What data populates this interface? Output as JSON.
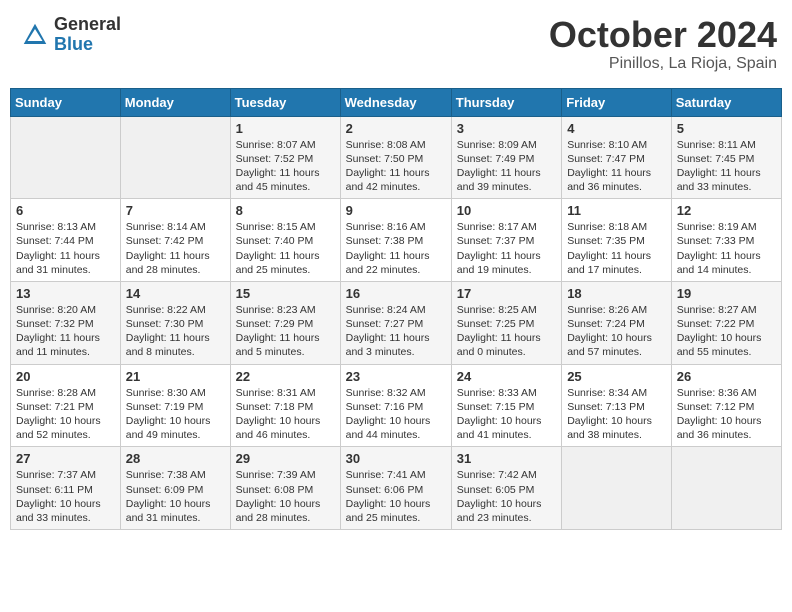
{
  "header": {
    "logo_general": "General",
    "logo_blue": "Blue",
    "month_title": "October 2024",
    "location": "Pinillos, La Rioja, Spain"
  },
  "weekdays": [
    "Sunday",
    "Monday",
    "Tuesday",
    "Wednesday",
    "Thursday",
    "Friday",
    "Saturday"
  ],
  "weeks": [
    [
      {
        "day": "",
        "empty": true
      },
      {
        "day": "",
        "empty": true
      },
      {
        "day": "1",
        "sunrise": "8:07 AM",
        "sunset": "7:52 PM",
        "daylight": "11 hours and 45 minutes."
      },
      {
        "day": "2",
        "sunrise": "8:08 AM",
        "sunset": "7:50 PM",
        "daylight": "11 hours and 42 minutes."
      },
      {
        "day": "3",
        "sunrise": "8:09 AM",
        "sunset": "7:49 PM",
        "daylight": "11 hours and 39 minutes."
      },
      {
        "day": "4",
        "sunrise": "8:10 AM",
        "sunset": "7:47 PM",
        "daylight": "11 hours and 36 minutes."
      },
      {
        "day": "5",
        "sunrise": "8:11 AM",
        "sunset": "7:45 PM",
        "daylight": "11 hours and 33 minutes."
      }
    ],
    [
      {
        "day": "6",
        "sunrise": "8:13 AM",
        "sunset": "7:44 PM",
        "daylight": "11 hours and 31 minutes."
      },
      {
        "day": "7",
        "sunrise": "8:14 AM",
        "sunset": "7:42 PM",
        "daylight": "11 hours and 28 minutes."
      },
      {
        "day": "8",
        "sunrise": "8:15 AM",
        "sunset": "7:40 PM",
        "daylight": "11 hours and 25 minutes."
      },
      {
        "day": "9",
        "sunrise": "8:16 AM",
        "sunset": "7:38 PM",
        "daylight": "11 hours and 22 minutes."
      },
      {
        "day": "10",
        "sunrise": "8:17 AM",
        "sunset": "7:37 PM",
        "daylight": "11 hours and 19 minutes."
      },
      {
        "day": "11",
        "sunrise": "8:18 AM",
        "sunset": "7:35 PM",
        "daylight": "11 hours and 17 minutes."
      },
      {
        "day": "12",
        "sunrise": "8:19 AM",
        "sunset": "7:33 PM",
        "daylight": "11 hours and 14 minutes."
      }
    ],
    [
      {
        "day": "13",
        "sunrise": "8:20 AM",
        "sunset": "7:32 PM",
        "daylight": "11 hours and 11 minutes."
      },
      {
        "day": "14",
        "sunrise": "8:22 AM",
        "sunset": "7:30 PM",
        "daylight": "11 hours and 8 minutes."
      },
      {
        "day": "15",
        "sunrise": "8:23 AM",
        "sunset": "7:29 PM",
        "daylight": "11 hours and 5 minutes."
      },
      {
        "day": "16",
        "sunrise": "8:24 AM",
        "sunset": "7:27 PM",
        "daylight": "11 hours and 3 minutes."
      },
      {
        "day": "17",
        "sunrise": "8:25 AM",
        "sunset": "7:25 PM",
        "daylight": "11 hours and 0 minutes."
      },
      {
        "day": "18",
        "sunrise": "8:26 AM",
        "sunset": "7:24 PM",
        "daylight": "10 hours and 57 minutes."
      },
      {
        "day": "19",
        "sunrise": "8:27 AM",
        "sunset": "7:22 PM",
        "daylight": "10 hours and 55 minutes."
      }
    ],
    [
      {
        "day": "20",
        "sunrise": "8:28 AM",
        "sunset": "7:21 PM",
        "daylight": "10 hours and 52 minutes."
      },
      {
        "day": "21",
        "sunrise": "8:30 AM",
        "sunset": "7:19 PM",
        "daylight": "10 hours and 49 minutes."
      },
      {
        "day": "22",
        "sunrise": "8:31 AM",
        "sunset": "7:18 PM",
        "daylight": "10 hours and 46 minutes."
      },
      {
        "day": "23",
        "sunrise": "8:32 AM",
        "sunset": "7:16 PM",
        "daylight": "10 hours and 44 minutes."
      },
      {
        "day": "24",
        "sunrise": "8:33 AM",
        "sunset": "7:15 PM",
        "daylight": "10 hours and 41 minutes."
      },
      {
        "day": "25",
        "sunrise": "8:34 AM",
        "sunset": "7:13 PM",
        "daylight": "10 hours and 38 minutes."
      },
      {
        "day": "26",
        "sunrise": "8:36 AM",
        "sunset": "7:12 PM",
        "daylight": "10 hours and 36 minutes."
      }
    ],
    [
      {
        "day": "27",
        "sunrise": "7:37 AM",
        "sunset": "6:11 PM",
        "daylight": "10 hours and 33 minutes."
      },
      {
        "day": "28",
        "sunrise": "7:38 AM",
        "sunset": "6:09 PM",
        "daylight": "10 hours and 31 minutes."
      },
      {
        "day": "29",
        "sunrise": "7:39 AM",
        "sunset": "6:08 PM",
        "daylight": "10 hours and 28 minutes."
      },
      {
        "day": "30",
        "sunrise": "7:41 AM",
        "sunset": "6:06 PM",
        "daylight": "10 hours and 25 minutes."
      },
      {
        "day": "31",
        "sunrise": "7:42 AM",
        "sunset": "6:05 PM",
        "daylight": "10 hours and 23 minutes."
      },
      {
        "day": "",
        "empty": true
      },
      {
        "day": "",
        "empty": true
      }
    ]
  ]
}
